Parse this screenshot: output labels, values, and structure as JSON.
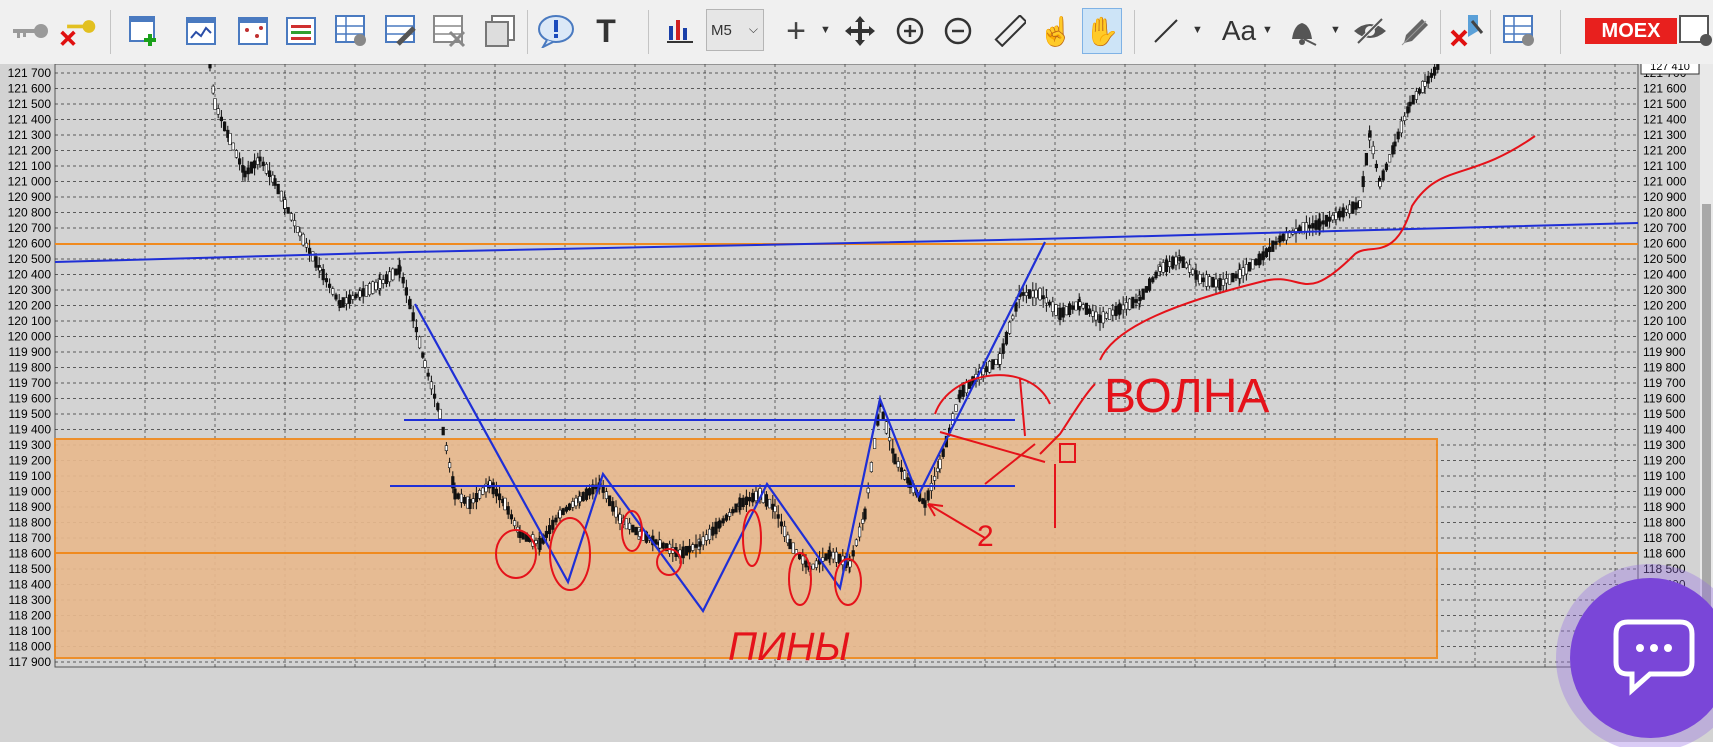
{
  "toolbar": {
    "timeframe": "M5",
    "font_button_label": "Aa",
    "exchange_badge": "MOEX",
    "icons": [
      "key-icon",
      "key-delete-icon",
      "new-chart-icon",
      "chart-window-icon",
      "scatter-window-icon",
      "list-window-icon",
      "table-window-icon",
      "settings-window-icon",
      "close-window-icon",
      "windows-icon",
      "alert-icon",
      "text-icon",
      "indicator-icon",
      "crosshair-icon",
      "move-icon",
      "zoom-in-icon",
      "zoom-out-icon",
      "ruler-icon",
      "pointer-hand-icon",
      "hand-icon",
      "line-icon",
      "font-icon",
      "bell-icon",
      "hide-icon",
      "pencil-icon",
      "remove-drawing-icon",
      "trade-window-icon"
    ]
  },
  "chart": {
    "current_price_label": "127 410",
    "price_ticks": [
      "121 700",
      "121 600",
      "121 500",
      "121 400",
      "121 300",
      "121 200",
      "121 100",
      "121 000",
      "120 900",
      "120 800",
      "120 700",
      "120 600",
      "120 500",
      "120 400",
      "120 300",
      "120 200",
      "120 100",
      "120 000",
      "119 900",
      "119 800",
      "119 700",
      "119 600",
      "119 500",
      "119 400",
      "119 300",
      "119 200",
      "119 100",
      "119 000",
      "118 900",
      "118 800",
      "118 700",
      "118 600",
      "118 500",
      "118 400",
      "118 300",
      "118 200",
      "118 100",
      "118 000",
      "117 900"
    ],
    "annotations": {
      "wave_label": "ВОЛНА",
      "pins_label": "ПИНЫ",
      "number_label": "2"
    },
    "colors": {
      "background": "#d3d3d3",
      "zone": "#e8b98e",
      "zone_border": "#f08a1e",
      "trend": "#1f2fd6",
      "drawing": "#e5121a",
      "grid": "#333333"
    }
  }
}
